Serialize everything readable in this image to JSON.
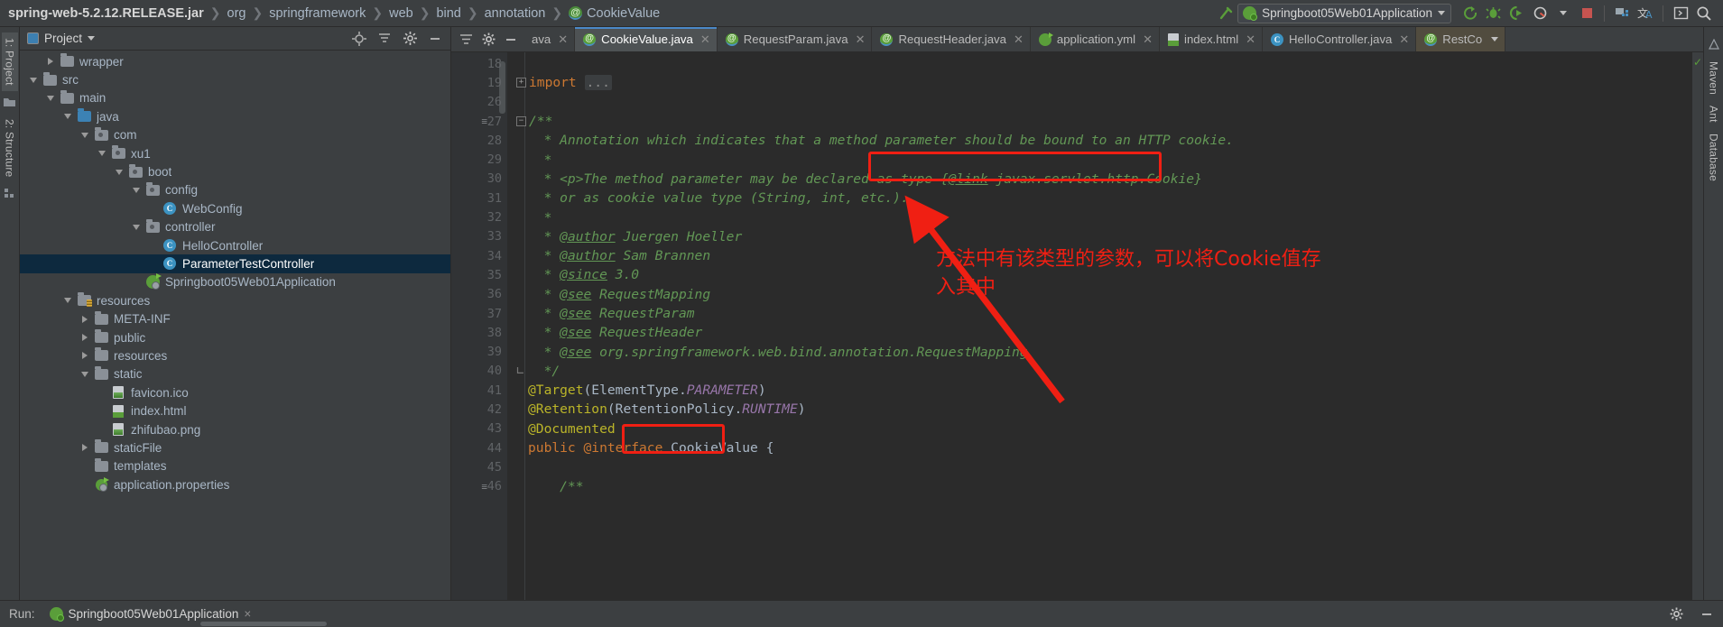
{
  "breadcrumb": {
    "items": [
      {
        "label": "spring-web-5.2.12.RELEASE.jar",
        "type": "jar"
      },
      {
        "label": "org",
        "type": "pkg"
      },
      {
        "label": "springframework",
        "type": "pkg"
      },
      {
        "label": "web",
        "type": "pkg"
      },
      {
        "label": "bind",
        "type": "pkg"
      },
      {
        "label": "annotation",
        "type": "pkg"
      },
      {
        "label": "CookieValue",
        "type": "annotation-class"
      }
    ],
    "separator": "❯"
  },
  "toolbar": {
    "run_configuration": "Springboot05Web01Application",
    "buttons": [
      {
        "name": "build-hammer-icon",
        "label": "Build"
      },
      {
        "name": "run-icon",
        "label": "Run"
      },
      {
        "name": "debug-icon",
        "label": "Debug"
      },
      {
        "name": "run-with-coverage-icon",
        "label": "Run with Coverage"
      },
      {
        "name": "profiler-icon",
        "label": "Profiler"
      },
      {
        "name": "stop-icon",
        "label": "Stop"
      },
      {
        "name": "update-project-icon",
        "label": "Update Project"
      },
      {
        "name": "translate-icon",
        "label": "Translate"
      },
      {
        "name": "terminal-icon",
        "label": "Terminal"
      },
      {
        "name": "search-everywhere-icon",
        "label": "Search Everywhere"
      }
    ]
  },
  "left_rail": {
    "tabs": [
      {
        "label": "1: Project",
        "active": true
      },
      {
        "label": "2: Structure",
        "active": false
      }
    ]
  },
  "right_rail": {
    "tabs": [
      {
        "label": "Maven"
      },
      {
        "label": "Ant"
      },
      {
        "label": "Database"
      }
    ]
  },
  "project_panel": {
    "title": "Project",
    "header_icons": [
      "locate-icon",
      "collapse-all-icon",
      "settings-gear-icon",
      "hide-icon"
    ],
    "tree": [
      {
        "label": "wrapper",
        "indent": 3,
        "twisty": "right",
        "icon": "folder",
        "selected": false
      },
      {
        "label": "src",
        "indent": 2,
        "twisty": "down",
        "icon": "folder",
        "selected": false
      },
      {
        "label": "main",
        "indent": 3,
        "twisty": "down",
        "icon": "folder",
        "selected": false
      },
      {
        "label": "java",
        "indent": 4,
        "twisty": "down",
        "icon": "folder-src",
        "selected": false
      },
      {
        "label": "com",
        "indent": 5,
        "twisty": "down",
        "icon": "folder-pkg",
        "selected": false
      },
      {
        "label": "xu1",
        "indent": 6,
        "twisty": "down",
        "icon": "folder-pkg",
        "selected": false
      },
      {
        "label": "boot",
        "indent": 7,
        "twisty": "down",
        "icon": "folder-pkg",
        "selected": false
      },
      {
        "label": "config",
        "indent": 8,
        "twisty": "down",
        "icon": "folder-pkg",
        "selected": false
      },
      {
        "label": "WebConfig",
        "indent": 9,
        "twisty": "none",
        "icon": "class",
        "selected": false
      },
      {
        "label": "controller",
        "indent": 8,
        "twisty": "down",
        "icon": "folder-pkg",
        "selected": false
      },
      {
        "label": "HelloController",
        "indent": 9,
        "twisty": "none",
        "icon": "class",
        "selected": false
      },
      {
        "label": "ParameterTestController",
        "indent": 9,
        "twisty": "none",
        "icon": "class",
        "selected": true
      },
      {
        "label": "Springboot05Web01Application",
        "indent": 8,
        "twisty": "none",
        "icon": "spring-boot",
        "selected": false
      },
      {
        "label": "resources",
        "indent": 4,
        "twisty": "down",
        "icon": "folder-res",
        "selected": false
      },
      {
        "label": "META-INF",
        "indent": 5,
        "twisty": "right",
        "icon": "folder",
        "selected": false
      },
      {
        "label": "public",
        "indent": 5,
        "twisty": "right",
        "icon": "folder",
        "selected": false
      },
      {
        "label": "resources",
        "indent": 5,
        "twisty": "right",
        "icon": "folder",
        "selected": false
      },
      {
        "label": "static",
        "indent": 5,
        "twisty": "down",
        "icon": "folder",
        "selected": false
      },
      {
        "label": "favicon.ico",
        "indent": 6,
        "twisty": "none",
        "icon": "file-image",
        "selected": false
      },
      {
        "label": "index.html",
        "indent": 6,
        "twisty": "none",
        "icon": "file-html",
        "selected": false
      },
      {
        "label": "zhifubao.png",
        "indent": 6,
        "twisty": "none",
        "icon": "file-image",
        "selected": false
      },
      {
        "label": "staticFile",
        "indent": 5,
        "twisty": "right",
        "icon": "folder",
        "selected": false
      },
      {
        "label": "templates",
        "indent": 5,
        "twisty": "none",
        "icon": "folder",
        "selected": false
      },
      {
        "label": "application.properties",
        "indent": 5,
        "twisty": "none",
        "icon": "file-spring",
        "selected": false
      }
    ]
  },
  "editor": {
    "tools": [
      "settings-gear-icon",
      "minimize-icon"
    ],
    "partial_tab": "ava",
    "tabs": [
      {
        "label": "CookieValue.java",
        "icon": "annotation",
        "active": true,
        "closable": true
      },
      {
        "label": "RequestParam.java",
        "icon": "annotation",
        "active": false,
        "closable": true
      },
      {
        "label": "RequestHeader.java",
        "icon": "annotation",
        "active": false,
        "closable": true
      },
      {
        "label": "application.yml",
        "icon": "spring-yml",
        "active": false,
        "closable": true
      },
      {
        "label": "index.html",
        "icon": "html",
        "active": false,
        "closable": true
      },
      {
        "label": "HelloController.java",
        "icon": "class",
        "active": false,
        "closable": true
      },
      {
        "label": "RestCo",
        "icon": "annotation",
        "active": false,
        "closable": false
      }
    ],
    "line_numbers": [
      "18",
      "19",
      "26",
      "27",
      "28",
      "29",
      "30",
      "31",
      "32",
      "33",
      "34",
      "35",
      "36",
      "37",
      "38",
      "39",
      "40",
      "41",
      "42",
      "43",
      "44",
      "45",
      "46"
    ],
    "lines": [
      {
        "num": "18",
        "segments": []
      },
      {
        "num": "19",
        "fold": "+",
        "segments": [
          {
            "t": "import ",
            "c": "kw"
          },
          {
            "t": "...",
            "c": "folded"
          }
        ]
      },
      {
        "num": "26",
        "segments": []
      },
      {
        "num": "27",
        "fold": "-",
        "gmark": "≡",
        "segments": [
          {
            "t": "/**",
            "c": "cmt"
          }
        ]
      },
      {
        "num": "28",
        "segments": [
          {
            "t": "  * Annotation which indicates that a method parameter should be bound to an HTTP cookie.",
            "c": "cmt"
          }
        ]
      },
      {
        "num": "29",
        "segments": [
          {
            "t": "  *",
            "c": "cmt"
          }
        ]
      },
      {
        "num": "30",
        "segments": [
          {
            "t": "  * <p>The method parameter may be declared as type ",
            "c": "cmt"
          },
          {
            "t": "{",
            "c": "cmt"
          },
          {
            "t": "@link",
            "c": "cmt-tag"
          },
          {
            "t": " javax.servlet.http.Cookie}",
            "c": "cmt"
          }
        ]
      },
      {
        "num": "31",
        "segments": [
          {
            "t": "  * or as cookie value type (String, int, etc.).",
            "c": "cmt"
          }
        ]
      },
      {
        "num": "32",
        "segments": [
          {
            "t": "  *",
            "c": "cmt"
          }
        ]
      },
      {
        "num": "33",
        "segments": [
          {
            "t": "  * ",
            "c": "cmt"
          },
          {
            "t": "@author",
            "c": "cmt-tag"
          },
          {
            "t": " Juergen Hoeller",
            "c": "cmt"
          }
        ]
      },
      {
        "num": "34",
        "segments": [
          {
            "t": "  * ",
            "c": "cmt"
          },
          {
            "t": "@author",
            "c": "cmt-tag"
          },
          {
            "t": " Sam Brannen",
            "c": "cmt"
          }
        ]
      },
      {
        "num": "35",
        "segments": [
          {
            "t": "  * ",
            "c": "cmt"
          },
          {
            "t": "@since",
            "c": "cmt-tag"
          },
          {
            "t": " 3.0",
            "c": "cmt"
          }
        ]
      },
      {
        "num": "36",
        "segments": [
          {
            "t": "  * ",
            "c": "cmt"
          },
          {
            "t": "@see",
            "c": "cmt-tag"
          },
          {
            "t": " RequestMapping",
            "c": "cmt"
          }
        ]
      },
      {
        "num": "37",
        "segments": [
          {
            "t": "  * ",
            "c": "cmt"
          },
          {
            "t": "@see",
            "c": "cmt-tag"
          },
          {
            "t": " RequestParam",
            "c": "cmt"
          }
        ]
      },
      {
        "num": "38",
        "segments": [
          {
            "t": "  * ",
            "c": "cmt"
          },
          {
            "t": "@see",
            "c": "cmt-tag"
          },
          {
            "t": " RequestHeader",
            "c": "cmt"
          }
        ]
      },
      {
        "num": "39",
        "segments": [
          {
            "t": "  * ",
            "c": "cmt"
          },
          {
            "t": "@see",
            "c": "cmt-tag"
          },
          {
            "t": " org.springframework.web.bind.annotation.RequestMapping",
            "c": "cmt"
          }
        ]
      },
      {
        "num": "40",
        "fold": "end",
        "segments": [
          {
            "t": "  */",
            "c": "cmt"
          }
        ]
      },
      {
        "num": "41",
        "segments": [
          {
            "t": "@Target",
            "c": "ann"
          },
          {
            "t": "(ElementType.",
            "c": "txt"
          },
          {
            "t": "PARAMETER",
            "c": "const"
          },
          {
            "t": ")",
            "c": "txt"
          }
        ]
      },
      {
        "num": "42",
        "segments": [
          {
            "t": "@Retention",
            "c": "ann"
          },
          {
            "t": "(RetentionPolicy.",
            "c": "txt"
          },
          {
            "t": "RUNTIME",
            "c": "const"
          },
          {
            "t": ")",
            "c": "txt"
          }
        ]
      },
      {
        "num": "43",
        "segments": [
          {
            "t": "@Documented",
            "c": "ann"
          }
        ]
      },
      {
        "num": "44",
        "segments": [
          {
            "t": "public ",
            "c": "kw"
          },
          {
            "t": "@interface ",
            "c": "kw"
          },
          {
            "t": "CookieValue ",
            "c": "txt"
          },
          {
            "t": "{",
            "c": "txt"
          }
        ]
      },
      {
        "num": "45",
        "segments": []
      },
      {
        "num": "46",
        "gmark": "≡",
        "segments": [
          {
            "t": "    /**",
            "c": "cmt"
          }
        ]
      }
    ]
  },
  "annotations": {
    "note_text": "方法中有该类型的参数，可以将Cookie值存\n入其中",
    "color": "#f01f13",
    "boxes": [
      {
        "name": "link-cookie-box"
      },
      {
        "name": "cookievalue-box"
      }
    ]
  },
  "bottom": {
    "run_label": "Run:",
    "run_tab": "Springboot05Web01Application",
    "close_label": "×",
    "icons": [
      "settings-gear-icon",
      "hide-icon"
    ]
  }
}
